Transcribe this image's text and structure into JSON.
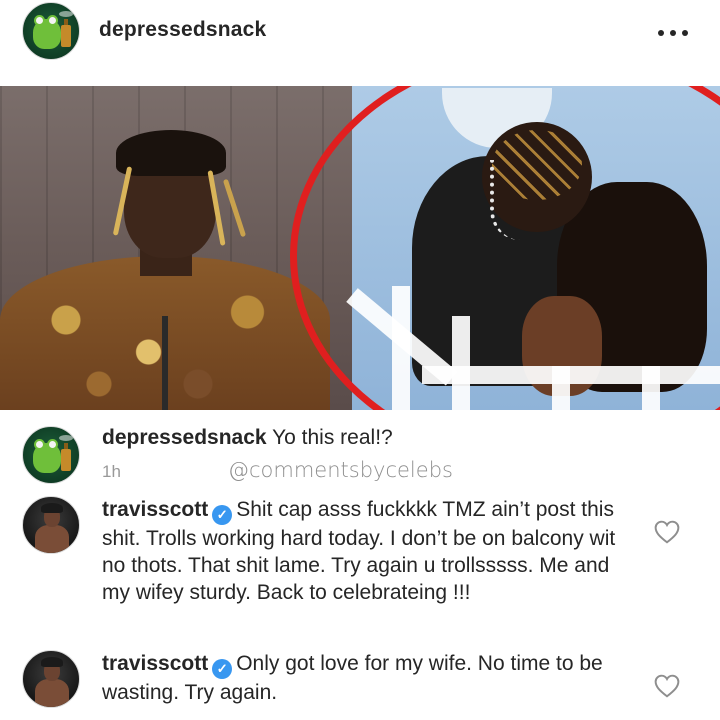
{
  "header": {
    "username": "depressedsnack",
    "more_icon": "more-horizontal-icon"
  },
  "post": {
    "image_description_icon": "photo"
  },
  "comments": [
    {
      "username": "depressedsnack",
      "text": "Yo this real!?",
      "time": "1h",
      "verified": false
    },
    {
      "username": "travisscott",
      "text": "Shit cap asss fuckkkk TMZ ain’t post this shit. Trolls working hard today. I don’t be on balcony wit no thots. That shit lame. Try again u trollsssss. Me and my wifey sturdy. Back to celebrateing !!!",
      "verified": true,
      "icon": "heart-icon"
    },
    {
      "username": "travisscott",
      "text": "Only got love for my wife. No time to be wasting. Try again.",
      "verified": true,
      "icon": "heart-icon"
    }
  ],
  "watermark": "@commentsbycelebs",
  "colors": {
    "text": "#262626",
    "muted": "#999999",
    "verified": "#3897f0",
    "red_circle": "#e01f1f"
  }
}
